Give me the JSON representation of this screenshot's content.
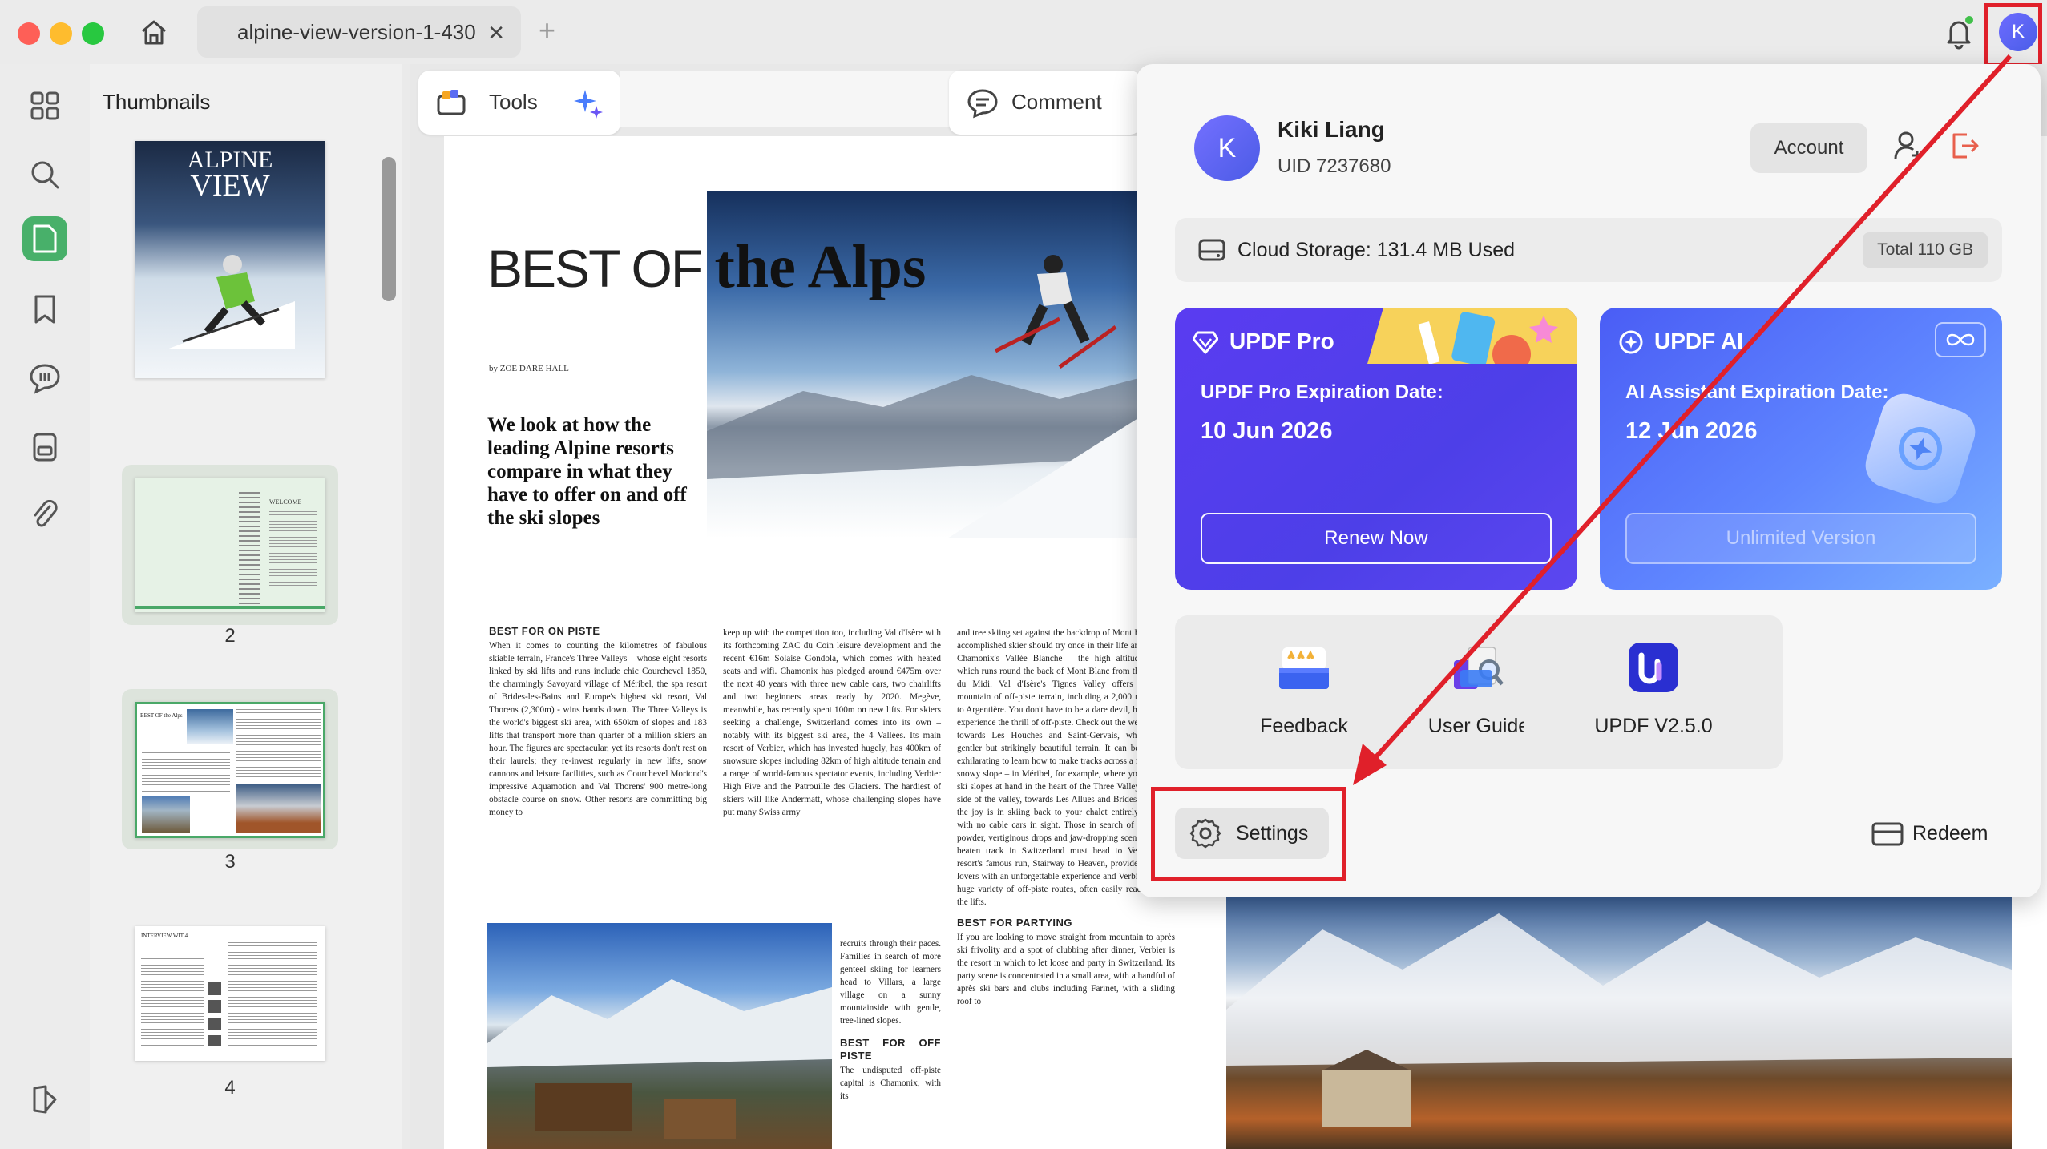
{
  "window": {
    "tab_title": "alpine-view-version-1-430",
    "tab_add": "+",
    "avatar_letter": "K"
  },
  "sidebar": {
    "items": [
      "thumbnails",
      "search",
      "page-organize",
      "bookmarks",
      "comments-list",
      "pages",
      "attachments",
      "layers"
    ],
    "active": "page-organize"
  },
  "thumbnails": {
    "title": "Thumbnails",
    "pages": [
      {
        "number": "1",
        "cover_title_line1": "ALPINE",
        "cover_title_line2": "VIEW"
      },
      {
        "number": "2",
        "heading": "WELCOME"
      },
      {
        "number": "3",
        "heading": "BEST OF the Alps"
      },
      {
        "number": "4",
        "heading": "INTERVIEW WIT 4"
      }
    ]
  },
  "toolbar": {
    "tools_label": "Tools",
    "comment_label": "Comment"
  },
  "article": {
    "headline_light": "BEST OF ",
    "headline_bold": "the Alps",
    "byline": "by ZOE DARE HALL",
    "intro": "We look at how the leading Alpine resorts compare in what they have to offer on and off the ski slopes",
    "col1_heading": "BEST FOR ON PISTE",
    "col1_text": "When it comes to counting the kilometres of fabulous skiable terrain, France's Three Valleys – whose eight resorts linked by ski lifts and runs include chic Courchevel 1850, the charmingly Savoyard village of Méribel, the spa resort of Brides-les-Bains and Europe's highest ski resort, Val Thorens (2,300m) - wins hands down. The Three Valleys is the world's biggest ski area, with 650km of slopes and 183 lifts that transport more than quarter of a million skiers an hour. The figures are spectacular, yet its resorts don't rest on their laurels; they re-invest regularly in new lifts, snow cannons and leisure facilities, such as Courchevel Moriond's impressive Aquamotion and Val Thorens' 900 metre-long obstacle course on snow. Other resorts are committing big money to",
    "col2_text": "keep up with the competition too, including Val d'Isère with its forthcoming ZAC du Coin leisure development and the recent €16m Solaise Gondola, which comes with heated seats and wifi. Chamonix has pledged around €475m over the next 40 years with three new cable cars, two chairlifts and two beginners areas ready by 2020. Megève, meanwhile, has recently spent 100m on new lifts. For skiers seeking a challenge, Switzerland comes into its own – notably with its biggest ski area, the 4 Vallées. Its main resort of Verbier, which has invested hugely, has 400km of snowsure slopes including 82km of high altitude terrain and a range of world-famous spectator events, including Verbier High Five and the Patrouille des Glaciers. The hardiest of skiers will like Andermatt, whose challenging slopes have put many Swiss army",
    "col2b_text": "recruits through their paces. Families in search of more genteel skiing for learners head to Villars, a large village on a sunny mountainside with gentle, tree-lined slopes.",
    "col2b_heading": "BEST FOR OFF PISTE",
    "col2c_text": "The undisputed off-piste capital is Chamonix, with its",
    "col3_text": "and tree skiing set against the backdrop of Mont Blanc. Any accomplished skier should try once in their life and descend Chamonix's Vallée Blanche – the high altitude glacier, which runs round the back of Mont Blanc from the Aiguille du Midi. Val d'Isère's Tignes Valley offers an entire mountain of off-piste terrain, including a 2,000 metre drop to Argentière. You don't have to be a dare devil, however, to experience the thrill of off-piste. Check out the western side, towards Les Houches and Saint-Gervais, which offers gentler but strikingly beautiful terrain. It can be similarly exhilarating to learn how to make tracks across a fresh, deep snowy slope – in Méribel, for example, where you have the ski slopes at hand in the heart of the Three Valleys. On one side of the valley, towards Les Allues and Brides les Bains, the joy is in skiing back to your chalet entirely off-piste, with no cable cars in sight. Those in search of untouched powder, vertiginous drops and jaw-dropping scenery off the beaten track in Switzerland must head to Verbier. The resort's famous run, Stairway to Heaven, provides off-piste lovers with an unforgettable experience and Verbier offers a huge variety of off-piste routes, often easily reached from the lifts.",
    "col3_heading": "BEST FOR PARTYING",
    "col3b_text": "If you are looking to move straight from mountain to après ski frivolity and a spot of clubbing after dinner, Verbier is the resort in which to let loose and party in Switzerland. Its party scene is concentrated in a small area, with a handful of après ski bars and clubs including Farinet, with a sliding roof to"
  },
  "account_popup": {
    "avatar_letter": "K",
    "name": "Kiki Liang",
    "uid": "UID 7237680",
    "account_button": "Account",
    "storage_text": "Cloud Storage: 131.4 MB Used",
    "storage_total": "Total 110 GB",
    "pro_card": {
      "title": "UPDF Pro",
      "expiration_label": "UPDF Pro Expiration Date:",
      "expiration_date": "10 Jun 2026",
      "button": "Renew Now"
    },
    "ai_card": {
      "title": "UPDF AI",
      "expiration_label": "AI Assistant Expiration Date:",
      "expiration_date": "12 Jun 2026",
      "button": "Unlimited Version"
    },
    "tiles": [
      {
        "label": "Feedback",
        "icon": "feedback-icon"
      },
      {
        "label": "User Guide",
        "icon": "user-guide-icon"
      },
      {
        "label": "UPDF V2.5.0",
        "icon": "updf-logo-icon"
      }
    ],
    "settings_label": "Settings",
    "redeem_label": "Redeem"
  },
  "colors": {
    "accent_green": "#48b06a",
    "pro_purple": "#4d3fe8",
    "ai_blue": "#5f86ff",
    "highlight_red": "#e0202a"
  }
}
